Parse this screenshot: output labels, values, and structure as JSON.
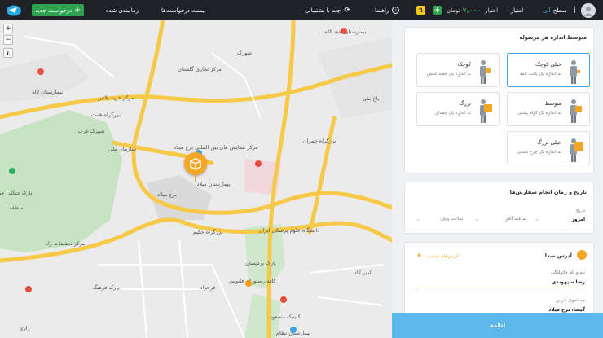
{
  "topbar": {
    "profile_label": "سطح",
    "profile_level": "آبی",
    "points_label": "امتیاز",
    "points_value": "۰",
    "credit_label": "اعتبار",
    "credit_value": "۷,۰۰۰",
    "credit_unit": "تومان",
    "help_label": "راهنما",
    "support_label": "چت با پشتیبانی",
    "requests_label": "لیست درخواست‌ها",
    "scheduled_label": "زمانبندی شده",
    "new_request_label": "درخواست جدید"
  },
  "map": {
    "labels": [
      "بیمارستان بقیه الله",
      "شهرک",
      "بیمارستان لاله",
      "مرکز خرید پلاتین",
      "مرکز تجاری گلستان",
      "پارک جنگلی چیتگر",
      "بیمارستان میلاد",
      "برج میلاد",
      "مرکز همایش های بین المللی برج میلاد",
      "دانشگاه علوم پزشکی ایران",
      "پارک پردیسان",
      "کافه رستوران فانوس",
      "کلینیک مسعود",
      "بیمارستان نظام",
      "پارک فرهنگ",
      "مرکز تحقیقات راه",
      "بزرگراه حکیم",
      "بزرگراه همت",
      "بزرگراه چمران",
      "امیر آباد",
      "باغ ملی",
      "سازمان ملی",
      "شهرک غرب",
      "فرحزاد",
      "منطقه",
      "رازی"
    ]
  },
  "panel": {
    "size_section_title": "متوسط اندازه هر مرسوله",
    "sizes": [
      {
        "name": "خیلی کوچک",
        "desc": "به اندازه یک پاکت نامه"
      },
      {
        "name": "کوچک",
        "desc": "به اندازه یک جعبه کفش"
      },
      {
        "name": "متوسط",
        "desc": "به اندازه یک کوله پشتی"
      },
      {
        "name": "بزرگ",
        "desc": "به اندازه یک چمدان"
      },
      {
        "name": "خیلی بزرگ",
        "desc": "به اندازه یک چرخ دستی"
      }
    ],
    "date_section_title": "تاریخ و زمان انجام سفارش‌ها",
    "date_label": "تاریخ",
    "date_value": "امروز",
    "start_time_placeholder": "ساعت آغاز",
    "end_time_placeholder": "ساعت پایان",
    "origin_title": "آدرس مبدا",
    "favorite_label": "آدرس‌های منتخب",
    "name_label": "نام و نام خانوادگی",
    "name_value": "رضا سپهوندی",
    "search_label": "جستجوی آدرس",
    "search_value": "گیشا، برج میلاد"
  },
  "cta": {
    "label": "ادامه"
  },
  "colors": {
    "accent": "#3fa6e3",
    "cta": "#5db7e9",
    "marker": "#f5a623",
    "green": "#2ea44f",
    "topbar": "#1f2126"
  }
}
